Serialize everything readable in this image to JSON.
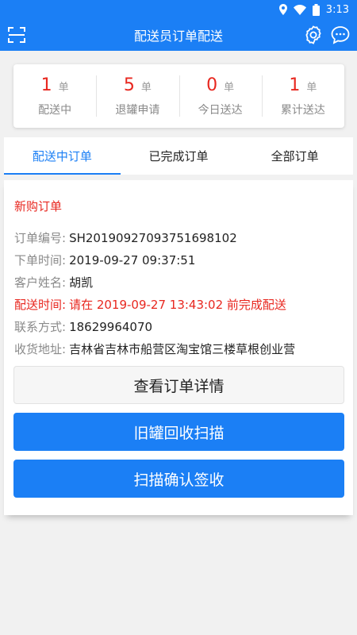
{
  "status_bar": {
    "time": "3:13",
    "icons": [
      "location-icon",
      "wifi-icon",
      "battery-icon"
    ]
  },
  "app_bar": {
    "title": "配送员订单配送",
    "icons": [
      "scan-icon",
      "gear-icon",
      "chat-icon"
    ]
  },
  "stats": [
    {
      "value": "1",
      "unit": "单",
      "label": "配送中"
    },
    {
      "value": "5",
      "unit": "单",
      "label": "退罐申请"
    },
    {
      "value": "0",
      "unit": "单",
      "label": "今日送达"
    },
    {
      "value": "1",
      "unit": "单",
      "label": "累计送达"
    }
  ],
  "tabs": [
    {
      "label": "配送中订单",
      "active": true
    },
    {
      "label": "已完成订单",
      "active": false
    },
    {
      "label": "全部订单",
      "active": false
    }
  ],
  "order": {
    "type": "新购订单",
    "rows": [
      {
        "key": "订单编号:",
        "value": "SH20190927093751698102"
      },
      {
        "key": "下单时间:",
        "value": "2019-09-27 09:37:51"
      },
      {
        "key": "客户姓名:",
        "value": "胡凯"
      },
      {
        "key": "配送时间:",
        "value": "请在 2019-09-27 13:43:02 前完成配送"
      },
      {
        "key": "联系方式:",
        "value": "18629964070"
      },
      {
        "key": "收货地址:",
        "value": "吉林省吉林市船营区淘宝馆三楼草根创业营"
      }
    ],
    "buttons": {
      "details": "查看订单详情",
      "recycle_scan": "旧罐回收扫描",
      "confirm_scan": "扫描确认签收"
    }
  },
  "colors": {
    "primary": "#1b7ff5",
    "accent_red": "#e8271f"
  }
}
